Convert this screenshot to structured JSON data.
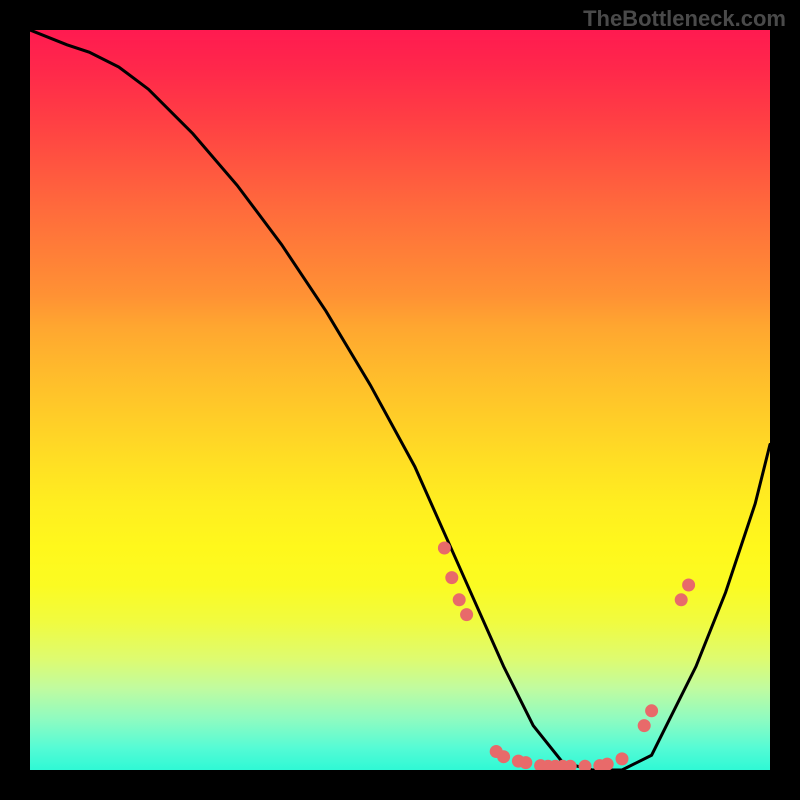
{
  "watermark": "TheBottleneck.com",
  "chart_data": {
    "type": "line",
    "title": "",
    "xlabel": "",
    "ylabel": "",
    "xlim": [
      0,
      100
    ],
    "ylim": [
      0,
      100
    ],
    "series": [
      {
        "name": "curve",
        "x": [
          0,
          5,
          8,
          12,
          16,
          22,
          28,
          34,
          40,
          46,
          52,
          56,
          60,
          64,
          68,
          72,
          76,
          80,
          84,
          86,
          90,
          94,
          98,
          100
        ],
        "y": [
          100,
          98,
          97,
          95,
          92,
          86,
          79,
          71,
          62,
          52,
          41,
          32,
          23,
          14,
          6,
          1,
          0,
          0,
          2,
          6,
          14,
          24,
          36,
          44
        ]
      }
    ],
    "markers": [
      {
        "x": 56,
        "y": 30
      },
      {
        "x": 57,
        "y": 26
      },
      {
        "x": 58,
        "y": 23
      },
      {
        "x": 59,
        "y": 21
      },
      {
        "x": 63,
        "y": 2.5
      },
      {
        "x": 64,
        "y": 1.8
      },
      {
        "x": 66,
        "y": 1.2
      },
      {
        "x": 67,
        "y": 1.0
      },
      {
        "x": 69,
        "y": 0.6
      },
      {
        "x": 70,
        "y": 0.5
      },
      {
        "x": 71,
        "y": 0.5
      },
      {
        "x": 72,
        "y": 0.5
      },
      {
        "x": 73,
        "y": 0.5
      },
      {
        "x": 75,
        "y": 0.5
      },
      {
        "x": 77,
        "y": 0.6
      },
      {
        "x": 78,
        "y": 0.8
      },
      {
        "x": 80,
        "y": 1.5
      },
      {
        "x": 83,
        "y": 6
      },
      {
        "x": 84,
        "y": 8
      },
      {
        "x": 88,
        "y": 23
      },
      {
        "x": 89,
        "y": 25
      }
    ],
    "gradient_stops": [
      {
        "pos": 0,
        "color": "#ff1a50"
      },
      {
        "pos": 50,
        "color": "#ffcc28"
      },
      {
        "pos": 80,
        "color": "#f0fb40"
      },
      {
        "pos": 100,
        "color": "#2ff9d5"
      }
    ]
  }
}
